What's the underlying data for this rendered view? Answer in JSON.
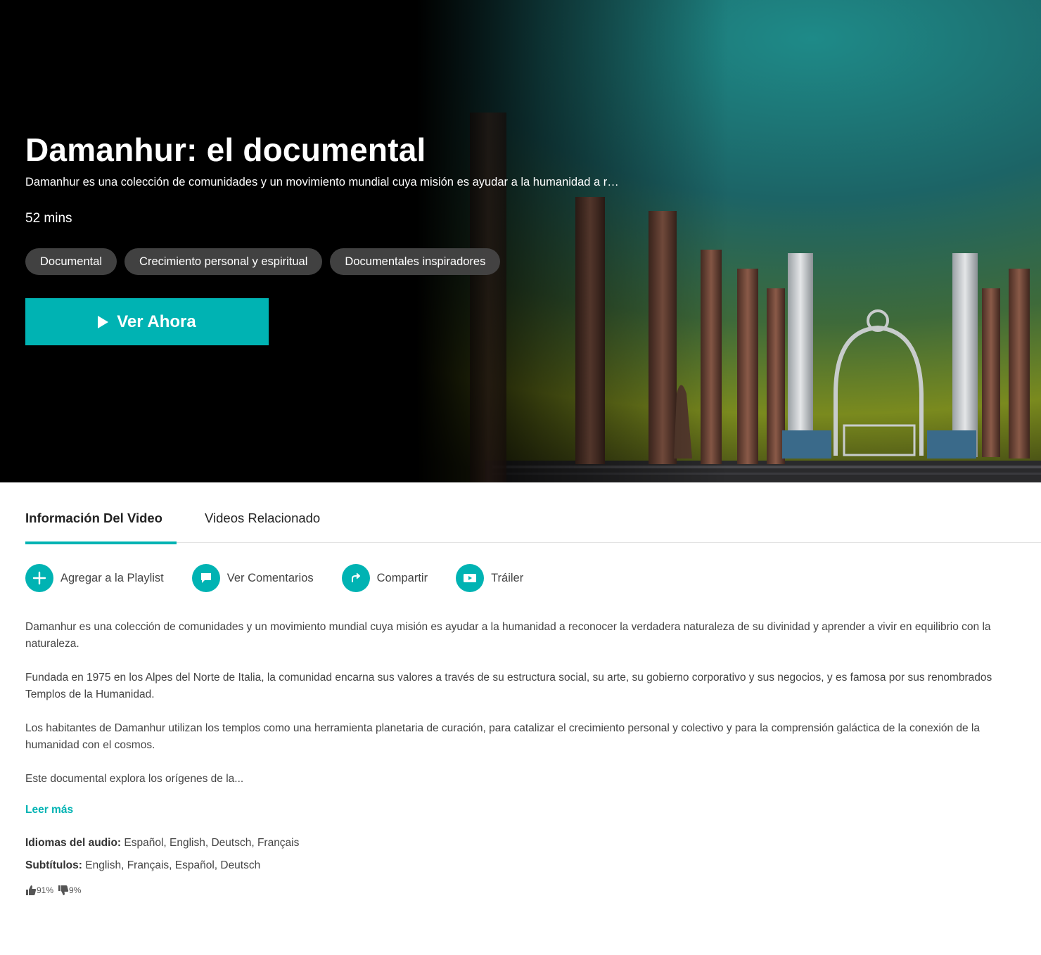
{
  "hero": {
    "title": "Damanhur: el documental",
    "short_description": "Damanhur es una colección de comunidades y un movimiento mundial cuya misión es ayudar a la humanidad a r…",
    "duration": "52 mins",
    "tags": [
      "Documental",
      "Crecimiento personal y espiritual",
      "Documentales inspiradores"
    ],
    "watch_label": "Ver Ahora"
  },
  "tabs": [
    {
      "label": "Información Del Video",
      "active": true
    },
    {
      "label": "Videos Relacionado",
      "active": false
    }
  ],
  "actions": [
    {
      "label": "Agregar a la Playlist",
      "icon": "plus-icon"
    },
    {
      "label": "Ver Comentarios",
      "icon": "comment-icon"
    },
    {
      "label": "Compartir",
      "icon": "share-icon"
    },
    {
      "label": "Tráiler",
      "icon": "video-icon"
    }
  ],
  "description": [
    "Damanhur es una colección de comunidades y un movimiento mundial cuya misión es ayudar a la humanidad a reconocer la verdadera naturaleza de su divinidad y aprender a vivir en equilibrio con la naturaleza.",
    "Fundada en 1975 en los Alpes del Norte de Italia, la comunidad encarna sus valores a través de su estructura social, su arte, su gobierno corporativo y sus negocios, y es famosa por sus renombrados Templos de la Humanidad.",
    "Los habitantes de Damanhur utilizan los templos como una herramienta planetaria de curación, para catalizar el crecimiento personal y colectivo y para la comprensión galáctica de la conexión de la humanidad con el cosmos.",
    "Este documental explora los orígenes de la..."
  ],
  "read_more": "Leer más",
  "audio": {
    "label": "Idiomas del audio:",
    "value": "Español, English, Deutsch, Français"
  },
  "subtitles": {
    "label": "Subtítulos:",
    "value": "English, Français, Español, Deutsch"
  },
  "ratings": {
    "up": "91%",
    "down": "9%"
  },
  "colors": {
    "accent": "#00b3b3",
    "hero_bg": "#000000"
  }
}
